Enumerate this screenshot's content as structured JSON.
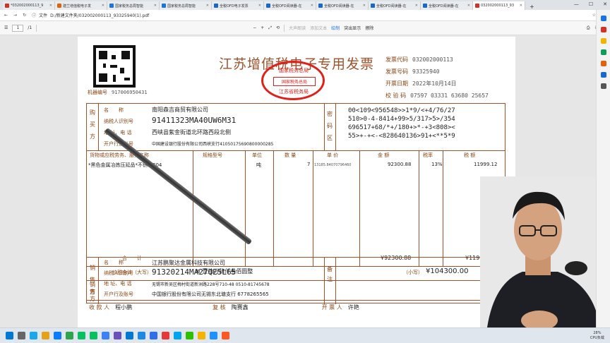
{
  "browser": {
    "tabs": [
      {
        "label": "*032002000113_9",
        "color": "#d93025",
        "active": false
      },
      {
        "label": "建兰增值税电子发",
        "color": "#e36209",
        "active": false
      },
      {
        "label": "国家税务总局智能",
        "color": "#1a73e8",
        "active": false
      },
      {
        "label": "国家税务总局智能",
        "color": "#1a73e8",
        "active": false
      },
      {
        "label": "全税OFD电子发票",
        "color": "#1967d2",
        "active": false
      },
      {
        "label": "全税OFD阅读器-在",
        "color": "#1967d2",
        "active": false
      },
      {
        "label": "全税OFD阅读器-在",
        "color": "#1967d2",
        "active": false
      },
      {
        "label": "全税OFD阅读器-在",
        "color": "#1967d2",
        "active": false
      },
      {
        "label": "全税OFD阅读器-在",
        "color": "#1967d2",
        "active": false
      },
      {
        "label": "032002000113_93",
        "color": "#d93025",
        "active": true
      }
    ],
    "new_tab": "+",
    "window_controls": {
      "minimize": "—",
      "maximize": "☐",
      "close": "✕"
    },
    "address": {
      "label": "文件",
      "url": "D:/新建文件夹/032002000113_93325940(1).pdf"
    }
  },
  "pdf_toolbar": {
    "menu": "☰",
    "page_current": "1",
    "page_total": "/1",
    "zoom_out": "−",
    "zoom_in": "+",
    "read_aloud": "大声朗读",
    "add_text": "添加文本",
    "draw": "绘制",
    "highlight": "突出显示",
    "erase": "擦除"
  },
  "invoice": {
    "title": "江苏增值税电子专用发票",
    "seal": {
      "top": "国家税务总局",
      "middle": "国家税务总局",
      "bottom": "江苏省税务局"
    },
    "meta": [
      {
        "label": "发票代码",
        "value": "032002000113"
      },
      {
        "label": "发票号码",
        "value": "93325940"
      },
      {
        "label": "开票日期",
        "value": "2022年10月14日"
      },
      {
        "label": "校 验 码",
        "value": "07597 03331 63680 25657"
      }
    ],
    "machine_label": "机器编号",
    "machine_value": "917006950431",
    "buyer": {
      "section": "购买方",
      "name_label": "名　　称",
      "name": "南阳森吉商贸有限公司",
      "tax_label": "纳税人识别号",
      "tax_id": "91411323MA40UW6M31",
      "addr_label": "地 址、电 话",
      "addr": "西峡县紫金街道北环路西段北侧",
      "bank_label": "开户行及账号",
      "bank": "中国建设银行股份有限公司西峡支行41050175690800000285"
    },
    "cipher_label": "密码区",
    "cipher": "00<109<956548>>1*9/<+4/76/27\n510>0-4-8414+99>5/317>5>/354\n696517+68/*+/180+>*-+3<808><\n55>+-+<-<828640136>91+<**5*9",
    "items_header": [
      "货物或应税劳务、服务名称",
      "规格型号",
      "单位",
      "数 量",
      "单 价",
      "金 额",
      "税率",
      "税 额"
    ],
    "items": [
      {
        "name": "*黑色金属冶炼压延品*不锈钢304",
        "spec": "",
        "unit": "吨",
        "qty": "7",
        "price": "13185.84070796460",
        "amount": "92300.88",
        "rate": "13%",
        "tax": "11999.12"
      }
    ],
    "total_label": "合　　计",
    "total_amount": "¥92300.88",
    "total_tax": "¥11999.12",
    "sum_label": "价税合计（大写）",
    "sum_upper": "壹拾万肆仟叁佰圆整",
    "sum_lower_label": "（小写）",
    "sum_lower": "¥104300.00",
    "seller": {
      "section": "销售方",
      "name_label": "名　　称",
      "name": "江苏鹏聚达金属科技有限公司",
      "tax_label": "纳税人识别号",
      "tax_id": "91320214MA27QE5L65",
      "addr_label": "地 址、电 话",
      "addr": "无锡市新吴区梅村街道新洲路228号710-48 0510-81745678",
      "bank_label": "开户行及账号",
      "bank": "中国银行股份有限公司无锡东北塘支行 6778265565"
    },
    "remark_label": "备注",
    "payee_label": "收 款 人",
    "payee": "程小鹏",
    "reviewer_label": "复 核",
    "reviewer": "陶赛鑫",
    "issuer_label": "开 票 人",
    "issuer": "许艳"
  },
  "taskbar": {
    "apps": [
      "#0078d4",
      "#666666",
      "#1aa7ec",
      "#e3a21a",
      "#0a7cff",
      "#2ea44f",
      "#07c160",
      "#07c160",
      "#3b82f6",
      "#6b4fbb",
      "#0078d4",
      "#1e88e5",
      "#2f6feb",
      "#e53935",
      "#00a4ef",
      "#2dc100",
      "#f4b400",
      "#1e90ff",
      "#ff5722"
    ],
    "cpu_percent": "28%",
    "cpu_label": "CPU负载"
  }
}
